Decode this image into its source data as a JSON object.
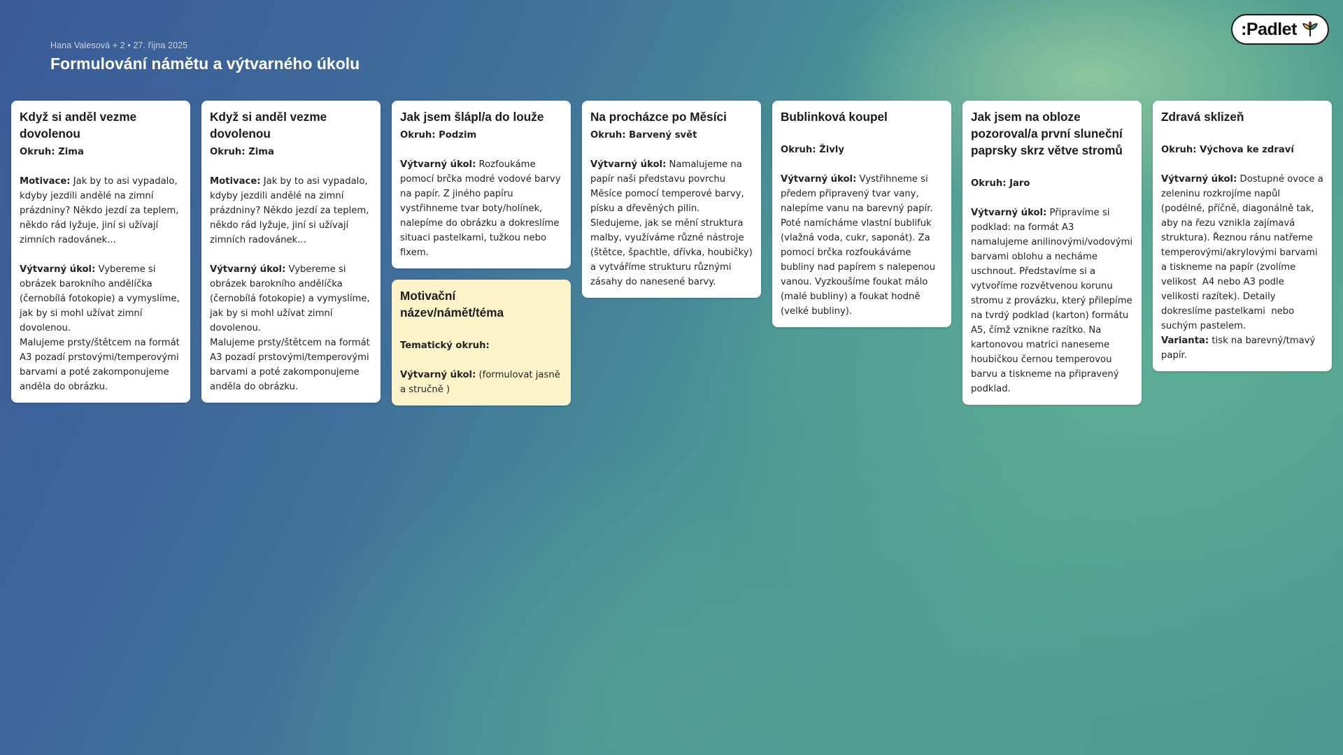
{
  "header": {
    "meta_author": "Hana Valesová + 2",
    "meta_sep": " • ",
    "meta_date": "27. října 2025",
    "title": "Formulování námětu a výtvarného úkolu"
  },
  "logo": {
    "text": ":Padlet"
  },
  "colors": {
    "card_white": "#ffffff",
    "card_yellow": "#fdf3c9"
  },
  "columns": [
    {
      "cards": [
        {
          "title": "Když si anděl vezme dovolenou",
          "okruh_label": "Okruh:",
          "okruh_value": " Zima",
          "motivace_label": "Motivace:",
          "motivace_text": " Jak by to asi vypadalo, kdyby jezdili andělé na zimní prázdniny? Někdo jezdí za teplem, někdo rád lyžuje, jiní si užívají zimních radovánek...",
          "ukol_label": "Výtvarný úkol:",
          "ukol_text": " Vybereme si obrázek barokního andělíčka (černobílá fotokopie) a vymyslíme, jak by si mohl užívat zimní dovolenou.",
          "extra_text": "Malujeme prsty/štětcem na formát A3 pozadí prstovými/temperovými barvami a poté zakomponujeme anděla do obrázku."
        }
      ]
    },
    {
      "cards": [
        {
          "title": "Když si anděl vezme dovolenou",
          "okruh_label": "Okruh:",
          "okruh_value": " Zima",
          "motivace_label": "Motivace:",
          "motivace_text": " Jak by to asi vypadalo, kdyby jezdili andělé na zimní prázdniny? Někdo jezdí za teplem, někdo rád lyžuje, jiní si užívají zimních radovánek...",
          "ukol_label": "Výtvarný úkol:",
          "ukol_text": " Vybereme si obrázek barokního andělíčka (černobílá fotokopie) a vymyslíme, jak by si mohl užívat zimní dovolenou.",
          "extra_text": "Malujeme prsty/štětcem na formát A3 pozadí prstovými/temperovými barvami a poté zakomponujeme anděla do obrázku."
        }
      ]
    },
    {
      "cards": [
        {
          "title": "Jak jsem šlápl/a do louže",
          "okruh_label": "Okruh: Podzim",
          "ukol_label": "Výtvarný úkol:",
          "ukol_text": " Rozfoukáme pomocí brčka modré vodové barvy na papír. Z jiného papíru vystřihneme tvar boty/holínek, nalepíme do obrázku a dokreslíme situaci pastelkami, tužkou nebo fixem."
        },
        {
          "title": "Motivační název/námět/téma",
          "okruh_label": "Tematický okruh:",
          "ukol_label": "Výtvarný úkol:",
          "ukol_text": " (formulovat jasně a stručně )"
        }
      ]
    },
    {
      "cards": [
        {
          "title": "Na procházce po Měsíci",
          "okruh_label": "Okruh: Barvený svět",
          "ukol_label": "Výtvarný úkol:",
          "ukol_text": " Namalujeme na papír naši představu povrchu Měsíce pomocí temperové barvy, písku a dřevěných pilin. Sledujeme, jak se mění struktura malby, využíváme různé nástroje (štětce, špachtle, dřívka, houbičky) a vytváříme strukturu různými zásahy do nanesené barvy."
        }
      ]
    },
    {
      "cards": [
        {
          "title": "Bublinková koupel",
          "okruh_label": "Okruh: Živly",
          "ukol_label": "Výtvarný úkol:",
          "ukol_text": " Vystřihneme si předem připravený tvar vany, nalepíme vanu na barevný papír. Poté namícháme vlastní bublifuk (vlažná voda, cukr, saponát). Za pomocí brčka rozfoukáváme bubliny nad papírem s nalepenou vanou. Vyzkoušíme foukat málo (malé bubliny) a foukat hodně (velké bubliny)."
        }
      ]
    },
    {
      "cards": [
        {
          "title": "Jak jsem na obloze pozoroval/a první sluneční paprsky skrz větve stromů",
          "okruh_label": "Okruh: Jaro",
          "ukol_label": "Výtvarný úkol:",
          "ukol_text": " Připravíme si podklad: na formát A3 namalujeme anilinovými/vodovými barvami oblohu a necháme uschnout. Představíme si a vytvoříme rozvětvenou korunu stromu z provázku, který přilepíme na tvrdý podklad (karton) formátu A5, čímž vznikne razítko. Na  kartonovou matrici naneseme houbičkou černou temperovou barvu a tiskneme na připravený podklad."
        }
      ]
    },
    {
      "cards": [
        {
          "title": "Zdravá sklizeň",
          "okruh_label": "Okruh: Výchova ke zdraví",
          "ukol_label": "Výtvarný úkol:",
          "ukol_text": " Dostupné ovoce a zeleninu rozkrojíme napůl (podélně, příčně, diagonálně tak, aby na řezu vznikla zajímavá struktura). Řeznou ránu natřeme temperovými/akrylovými barvami a tiskneme na papír (zvolíme velikost  A4 nebo A3 podle velikosti razítek). Detaily dokreslíme pastelkami  nebo suchým pastelem.",
          "varianta_label": "Varianta:",
          "varianta_text": " tisk na barevný/tmavý papír."
        }
      ]
    }
  ]
}
